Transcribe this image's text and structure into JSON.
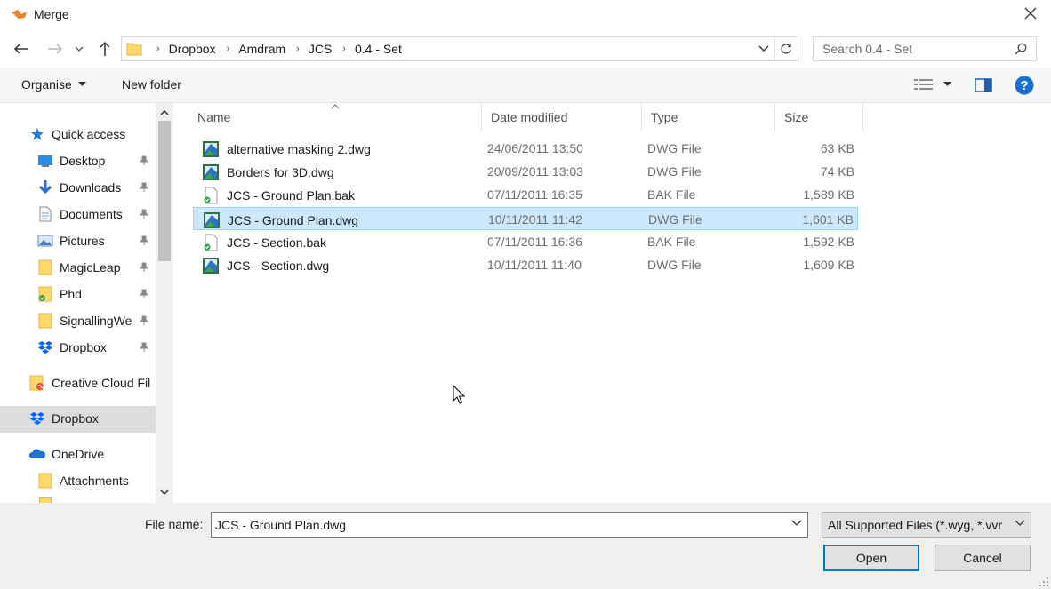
{
  "window": {
    "title": "Merge",
    "close_label": "✕"
  },
  "address": {
    "breadcrumbs": [
      "Dropbox",
      "Amdram",
      "JCS",
      "0.4 - Set"
    ],
    "search_placeholder": "Search 0.4 - Set"
  },
  "toolbar": {
    "organise_label": "Organise",
    "new_folder_label": "New folder"
  },
  "nav": {
    "items": [
      {
        "label": "Quick access",
        "icon": "star-icon",
        "pinned": false
      },
      {
        "label": "Desktop",
        "icon": "desktop-icon",
        "pinned": true
      },
      {
        "label": "Downloads",
        "icon": "download-arrow-icon",
        "pinned": true
      },
      {
        "label": "Documents",
        "icon": "documents-icon",
        "pinned": true
      },
      {
        "label": "Pictures",
        "icon": "pictures-icon",
        "pinned": true
      },
      {
        "label": "MagicLeap",
        "icon": "folder-icon",
        "pinned": true
      },
      {
        "label": "Phd",
        "icon": "folder-synced-icon",
        "pinned": true
      },
      {
        "label": "SignallingWe",
        "icon": "folder-icon",
        "pinned": true
      },
      {
        "label": "Dropbox",
        "icon": "dropbox-icon",
        "pinned": true
      },
      {
        "label": "Creative Cloud Fil",
        "icon": "creative-cloud-folder-icon",
        "pinned": false
      },
      {
        "label": "Dropbox",
        "icon": "dropbox-icon",
        "pinned": false
      },
      {
        "label": "OneDrive",
        "icon": "onedrive-cloud-icon",
        "pinned": false
      },
      {
        "label": "Attachments",
        "icon": "folder-icon",
        "pinned": false
      }
    ]
  },
  "columns": {
    "name": "Name",
    "date": "Date modified",
    "type": "Type",
    "size": "Size"
  },
  "files": [
    {
      "name": "alternative masking 2.dwg",
      "date": "24/06/2011 13:50",
      "type": "DWG File",
      "size": "63 KB",
      "icon": "dwg-file-icon",
      "selected": false
    },
    {
      "name": "Borders for 3D.dwg",
      "date": "20/09/2011 13:03",
      "type": "DWG File",
      "size": "74 KB",
      "icon": "dwg-file-icon",
      "selected": false
    },
    {
      "name": "JCS - Ground Plan.bak",
      "date": "07/11/2011 16:35",
      "type": "BAK File",
      "size": "1,589 KB",
      "icon": "bak-file-icon",
      "selected": false
    },
    {
      "name": "JCS - Ground Plan.dwg",
      "date": "10/11/2011 11:42",
      "type": "DWG File",
      "size": "1,601 KB",
      "icon": "dwg-file-icon",
      "selected": true
    },
    {
      "name": "JCS - Section.bak",
      "date": "07/11/2011 16:36",
      "type": "BAK File",
      "size": "1,592 KB",
      "icon": "bak-file-icon",
      "selected": false
    },
    {
      "name": "JCS - Section.dwg",
      "date": "10/11/2011 11:40",
      "type": "DWG File",
      "size": "1,609 KB",
      "icon": "dwg-file-icon",
      "selected": false
    }
  ],
  "footer": {
    "filename_label": "File name:",
    "filename_value": "JCS - Ground Plan.dwg",
    "filter_value": "All Supported Files (*.wyg, *.vvr",
    "open_label": "Open",
    "cancel_label": "Cancel"
  },
  "colors": {
    "selection": "#cce8ff",
    "selection_border": "#99d1ff",
    "accent": "#0078d7"
  }
}
